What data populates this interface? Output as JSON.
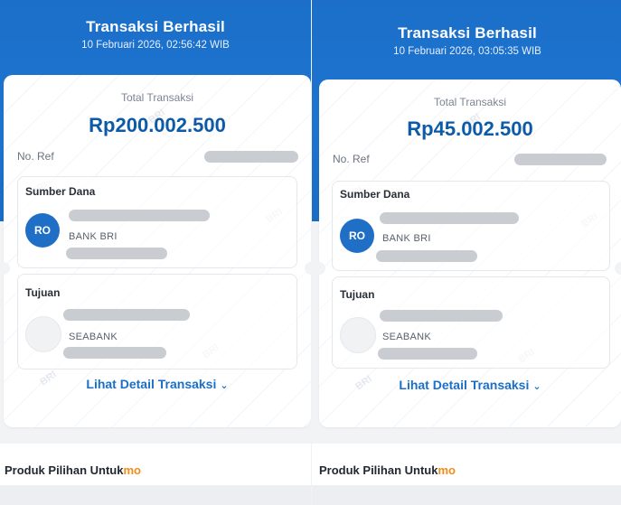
{
  "screens": [
    {
      "header_title": "Transaksi Berhasil",
      "header_datetime": "10 Februari 2026, 02:56:42 WIB",
      "total_label": "Total Transaksi",
      "total_amount": "Rp200.002.500",
      "ref_label": "No. Ref",
      "source_title": "Sumber Dana",
      "source_avatar": "RO",
      "source_bank": "BANK BRI",
      "dest_title": "Tujuan",
      "dest_bank": "SEABANK",
      "detail_link": "Lihat Detail Transaksi",
      "produk_text": "Produk Pilihan Untuk",
      "produk_suffix": "mo"
    },
    {
      "header_title": "Transaksi Berhasil",
      "header_datetime": "10 Februari 2026, 03:05:35 WIB",
      "total_label": "Total Transaksi",
      "total_amount": "Rp45.002.500",
      "ref_label": "No. Ref",
      "source_title": "Sumber Dana",
      "source_avatar": "RO",
      "source_bank": "BANK BRI",
      "dest_title": "Tujuan",
      "dest_bank": "SEABANK",
      "detail_link": "Lihat Detail Transaksi",
      "produk_text": "Produk Pilihan Untuk",
      "produk_suffix": "mo"
    }
  ],
  "watermark_text": "BRI",
  "colors": {
    "header_blue": "#1d74cf",
    "amount_blue": "#0c5aa8",
    "link_blue": "#1b6fc9",
    "avatar_blue": "#1f6fc6",
    "mo_orange": "#f08c1a"
  },
  "icons": {
    "detail_chevron": "chevron-down-icon"
  }
}
